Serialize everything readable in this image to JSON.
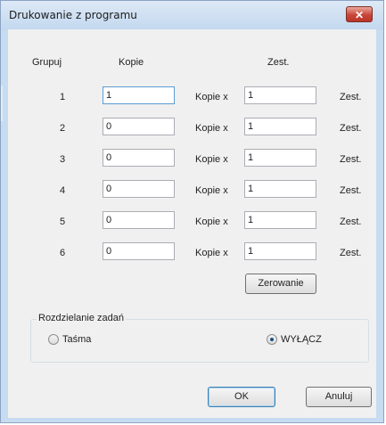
{
  "window": {
    "title": "Drukowanie z programu",
    "close_glyph": "✕"
  },
  "headers": {
    "group": "Grupuj",
    "copies": "Kopie",
    "sets": "Zest."
  },
  "rows": [
    {
      "group": "1",
      "copies": "1",
      "copies_label": "Kopie x",
      "sets": "1",
      "sets_label": "Zest."
    },
    {
      "group": "2",
      "copies": "0",
      "copies_label": "Kopie x",
      "sets": "1",
      "sets_label": "Zest."
    },
    {
      "group": "3",
      "copies": "0",
      "copies_label": "Kopie x",
      "sets": "1",
      "sets_label": "Zest."
    },
    {
      "group": "4",
      "copies": "0",
      "copies_label": "Kopie x",
      "sets": "1",
      "sets_label": "Zest."
    },
    {
      "group": "5",
      "copies": "0",
      "copies_label": "Kopie x",
      "sets": "1",
      "sets_label": "Zest."
    },
    {
      "group": "6",
      "copies": "0",
      "copies_label": "Kopie x",
      "sets": "1",
      "sets_label": "Zest."
    }
  ],
  "zero_button": "Zerowanie",
  "job_split": {
    "label": "Rozdzielanie zadań",
    "options": [
      {
        "label": "Taśma",
        "checked": false
      },
      {
        "label": "WYŁĄCZ",
        "checked": true
      }
    ]
  },
  "footer": {
    "ok": "OK",
    "cancel": "Anuluj"
  },
  "colors": {
    "titlebar": "#c3d8ef",
    "client": "#f0f0f0",
    "close": "#c9463a"
  }
}
